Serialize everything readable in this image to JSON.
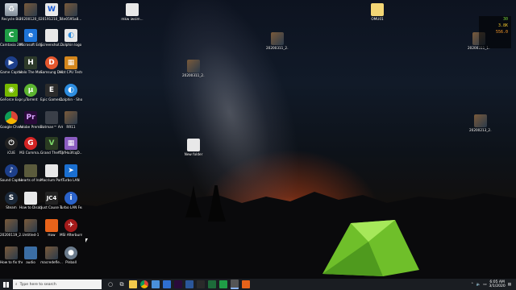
{
  "desktop_icons": [
    {
      "name": "recycle-bin",
      "label": "Recycle Bin",
      "kind": "recycle"
    },
    {
      "name": "file-20200120",
      "label": "20200120_0...",
      "kind": "photo"
    },
    {
      "name": "file-20191210",
      "label": "20191210_1...",
      "kind": "doc"
    },
    {
      "name": "file-ndlt",
      "label": "f4e0595a8...",
      "kind": "photo"
    },
    {
      "name": "mkw-folder",
      "label": "mkw iwsim...",
      "kind": "folder"
    },
    {
      "name": "omu-folder",
      "label": "OMU01",
      "kind": "folder"
    },
    {
      "name": "camtasia",
      "label": "Camtasia 2019",
      "kind": "camtasia"
    },
    {
      "name": "edge",
      "label": "Microsoft Edge",
      "kind": "edge"
    },
    {
      "name": "screenshot",
      "label": "Screenshot...",
      "kind": "doc"
    },
    {
      "name": "dolphin-logo",
      "label": "Dolphin logo",
      "kind": "doc"
    },
    {
      "name": "photo-mid",
      "label": "20200311_2...",
      "kind": "photo"
    },
    {
      "name": "photo-right",
      "label": "20200311_1...",
      "kind": "photo"
    },
    {
      "name": "game-capture",
      "label": "Game Capture HD",
      "kind": "elgato"
    },
    {
      "name": "halo",
      "label": "Halo The Master Chi...",
      "kind": "halo"
    },
    {
      "name": "samsung-dex",
      "label": "Samsung DeX",
      "kind": "dex"
    },
    {
      "name": "hot-cpu",
      "label": "Hot CPU Tester Pro",
      "kind": "cpu"
    },
    {
      "name": "photo-center",
      "label": "20200311_2...",
      "kind": "photo"
    },
    {
      "name": "geforce",
      "label": "GeForce Experience",
      "kind": "nvidia"
    },
    {
      "name": "utorrent",
      "label": "µTorrent",
      "kind": "utorrent"
    },
    {
      "name": "epic",
      "label": "Epic Games Launcher",
      "kind": "epic"
    },
    {
      "name": "dolphin-shortcut",
      "label": "Dolphin - Shortcut (2)",
      "kind": "dolphin"
    },
    {
      "name": "chrome",
      "label": "Google Chrome",
      "kind": "chrome"
    },
    {
      "name": "premiere",
      "label": "Adobe Premiere P...",
      "kind": "premiere"
    },
    {
      "name": "batman",
      "label": "Batman™ Arkham K...",
      "kind": "game"
    },
    {
      "name": "rr11",
      "label": "RR11",
      "kind": "photo"
    },
    {
      "name": "photo-right2",
      "label": "20200213_2...",
      "kind": "photo"
    },
    {
      "name": "icue",
      "label": "iCUE",
      "kind": "icue"
    },
    {
      "name": "m3-comma",
      "label": "M3 Comma...",
      "kind": "m3"
    },
    {
      "name": "gta5",
      "label": "Grand Theft Auto V",
      "kind": "gta"
    },
    {
      "name": "tpfh",
      "label": "TpfHo3fcqD...",
      "kind": "grid"
    },
    {
      "name": "new-folder",
      "label": "New folder",
      "kind": "folder"
    },
    {
      "name": "sound-capture",
      "label": "Sound Capture",
      "kind": "elgato"
    },
    {
      "name": "hearts-of-iron",
      "label": "Hearts of Iron IV Man the...",
      "kind": "game"
    },
    {
      "name": "macrium",
      "label": "Macrium Partition...",
      "kind": "doc"
    },
    {
      "name": "turbo-lan",
      "label": "Turbo LAN",
      "kind": "turbo"
    },
    {
      "name": "steam",
      "label": "Steam",
      "kind": "steam"
    },
    {
      "name": "disable-cm",
      "label": "How to Disable on...",
      "kind": "doc"
    },
    {
      "name": "jc4",
      "label": "Just Cause 4",
      "kind": "jc4"
    },
    {
      "name": "turbo-lan-features",
      "label": "Turbo LAN Features",
      "kind": "info"
    },
    {
      "name": "photo-lower",
      "label": "20200119_2...",
      "kind": "photo"
    },
    {
      "name": "untitled",
      "label": "Untitled-1",
      "kind": "photo"
    },
    {
      "name": "how",
      "label": "How",
      "kind": "orange"
    },
    {
      "name": "msi-afterburner",
      "label": "MSI Afterburner",
      "kind": "msi"
    },
    {
      "name": "how-to-fix",
      "label": "How to fix the 3 Secon...",
      "kind": "photo"
    },
    {
      "name": "audio",
      "label": "audio",
      "kind": "photo"
    },
    {
      "name": "macredefle",
      "label": "macredefle...",
      "kind": "photo"
    },
    {
      "name": "pinball",
      "label": "Pinball",
      "kind": "pinball"
    }
  ],
  "overlay": {
    "line1": "30",
    "line2": "3.8K",
    "line3": "556.0",
    "colors": [
      "#7bd63b",
      "#f0c52b",
      "#ff9c2b"
    ]
  },
  "taskbar": {
    "search_placeholder": "Type here to search",
    "time": "6:05 AM",
    "date": "3/1/2020",
    "apps": [
      "cortana",
      "task-view",
      "explorer",
      "chrome",
      "store",
      "mail",
      "premiere",
      "word",
      "obs",
      "photoshop",
      "camtasia",
      "monitor",
      "app-orange"
    ]
  },
  "colors": {
    "taskbar_bg": "#1a1d22",
    "tent_green": "#8bd63a"
  }
}
